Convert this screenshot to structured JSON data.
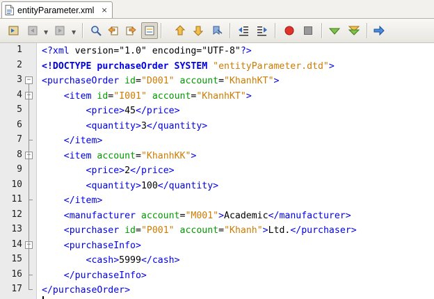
{
  "tab": {
    "title": "entityParameter.xml",
    "close": "×"
  },
  "toolbar": {
    "buttons": [
      "source-view-icon",
      "back-icon",
      "forward-icon",
      "find-icon",
      "find-previous-icon",
      "find-next-icon",
      "toggle-highlight-icon",
      "previous-bookmark-icon",
      "next-bookmark-icon",
      "toggle-bookmark-icon",
      "shift-left-icon",
      "shift-right-icon",
      "record-macro-icon",
      "stop-macro-icon",
      "check-xml-icon",
      "validate-xml-icon",
      "xsl-transform-icon"
    ]
  },
  "colors": {
    "tag": "#0000e6",
    "attribute": "#009900",
    "value": "#ce7b00",
    "text": "#000000",
    "gutter": "#ebebeb"
  },
  "editor": {
    "lines": [
      {
        "n": "1",
        "fold": "",
        "seg": [
          [
            "tag",
            "<?xml "
          ],
          [
            "txt",
            "version=\"1.0\" encoding=\"UTF-8\""
          ],
          [
            "tag",
            "?>"
          ]
        ]
      },
      {
        "n": "2",
        "fold": "",
        "seg": [
          [
            "tag b",
            "<!DOCTYPE purchaseOrder SYSTEM "
          ],
          [
            "val",
            "\"entityParameter.dtd\""
          ],
          [
            "tag",
            "&gt;"
          ]
        ]
      },
      {
        "n": "3",
        "fold": "open",
        "seg": [
          [
            "tag",
            "<purchaseOrder "
          ],
          [
            "attr",
            "id"
          ],
          [
            "txt",
            "="
          ],
          [
            "val",
            "\"D001\" "
          ],
          [
            "attr",
            "account"
          ],
          [
            "txt",
            "="
          ],
          [
            "val",
            "\"KhanhKT\""
          ],
          [
            "tag",
            ">"
          ]
        ]
      },
      {
        "n": "4",
        "fold": "open",
        "seg": [
          [
            "txt",
            "    "
          ],
          [
            "tag",
            "<item "
          ],
          [
            "attr",
            "id"
          ],
          [
            "txt",
            "="
          ],
          [
            "val",
            "\"I001\" "
          ],
          [
            "attr",
            "account"
          ],
          [
            "txt",
            "="
          ],
          [
            "val",
            "\"KhanhKT\""
          ],
          [
            "tag",
            ">"
          ]
        ]
      },
      {
        "n": "5",
        "fold": "",
        "seg": [
          [
            "txt",
            "        "
          ],
          [
            "tag",
            "<price>"
          ],
          [
            "txt",
            "45"
          ],
          [
            "tag",
            "</price>"
          ]
        ]
      },
      {
        "n": "6",
        "fold": "",
        "seg": [
          [
            "txt",
            "        "
          ],
          [
            "tag",
            "<quantity>"
          ],
          [
            "txt",
            "3"
          ],
          [
            "tag",
            "</quantity>"
          ]
        ]
      },
      {
        "n": "7",
        "fold": "end",
        "seg": [
          [
            "txt",
            "    "
          ],
          [
            "tag",
            "</item>"
          ]
        ]
      },
      {
        "n": "8",
        "fold": "open",
        "seg": [
          [
            "txt",
            "    "
          ],
          [
            "tag",
            "<item "
          ],
          [
            "attr",
            "account"
          ],
          [
            "txt",
            "="
          ],
          [
            "val",
            "\"KhanhKK\""
          ],
          [
            "tag",
            ">"
          ]
        ]
      },
      {
        "n": "9",
        "fold": "",
        "seg": [
          [
            "txt",
            "        "
          ],
          [
            "tag",
            "<price>"
          ],
          [
            "txt",
            "2"
          ],
          [
            "tag",
            "</price>"
          ]
        ]
      },
      {
        "n": "10",
        "fold": "",
        "seg": [
          [
            "txt",
            "        "
          ],
          [
            "tag",
            "<quantity>"
          ],
          [
            "txt",
            "100"
          ],
          [
            "tag",
            "</quantity>"
          ]
        ]
      },
      {
        "n": "11",
        "fold": "end",
        "seg": [
          [
            "txt",
            "    "
          ],
          [
            "tag",
            "</item>"
          ]
        ]
      },
      {
        "n": "12",
        "fold": "",
        "seg": [
          [
            "txt",
            "    "
          ],
          [
            "tag",
            "<manufacturer "
          ],
          [
            "attr",
            "account"
          ],
          [
            "txt",
            "="
          ],
          [
            "val",
            "\"M001\""
          ],
          [
            "tag",
            ">"
          ],
          [
            "txt",
            "Academic"
          ],
          [
            "tag",
            "</manufacturer>"
          ]
        ]
      },
      {
        "n": "13",
        "fold": "",
        "seg": [
          [
            "txt",
            "    "
          ],
          [
            "tag",
            "<purchaser "
          ],
          [
            "attr",
            "id"
          ],
          [
            "txt",
            "="
          ],
          [
            "val",
            "\"P001\" "
          ],
          [
            "attr",
            "account"
          ],
          [
            "txt",
            "="
          ],
          [
            "val",
            "\"Khanh\""
          ],
          [
            "tag",
            ">"
          ],
          [
            "txt",
            "Ltd."
          ],
          [
            "tag",
            "</purchaser>"
          ]
        ]
      },
      {
        "n": "14",
        "fold": "open",
        "seg": [
          [
            "txt",
            "    "
          ],
          [
            "tag",
            "<purchaseInfo>"
          ]
        ]
      },
      {
        "n": "15",
        "fold": "",
        "seg": [
          [
            "txt",
            "        "
          ],
          [
            "tag",
            "<cash>"
          ],
          [
            "txt",
            "5999"
          ],
          [
            "tag",
            "</cash>"
          ]
        ]
      },
      {
        "n": "16",
        "fold": "end",
        "seg": [
          [
            "txt",
            "    "
          ],
          [
            "tag",
            "</purchaseInfo>"
          ]
        ]
      },
      {
        "n": "17",
        "fold": "end",
        "seg": [
          [
            "tag",
            "</purchaseOrder>"
          ]
        ]
      }
    ]
  }
}
